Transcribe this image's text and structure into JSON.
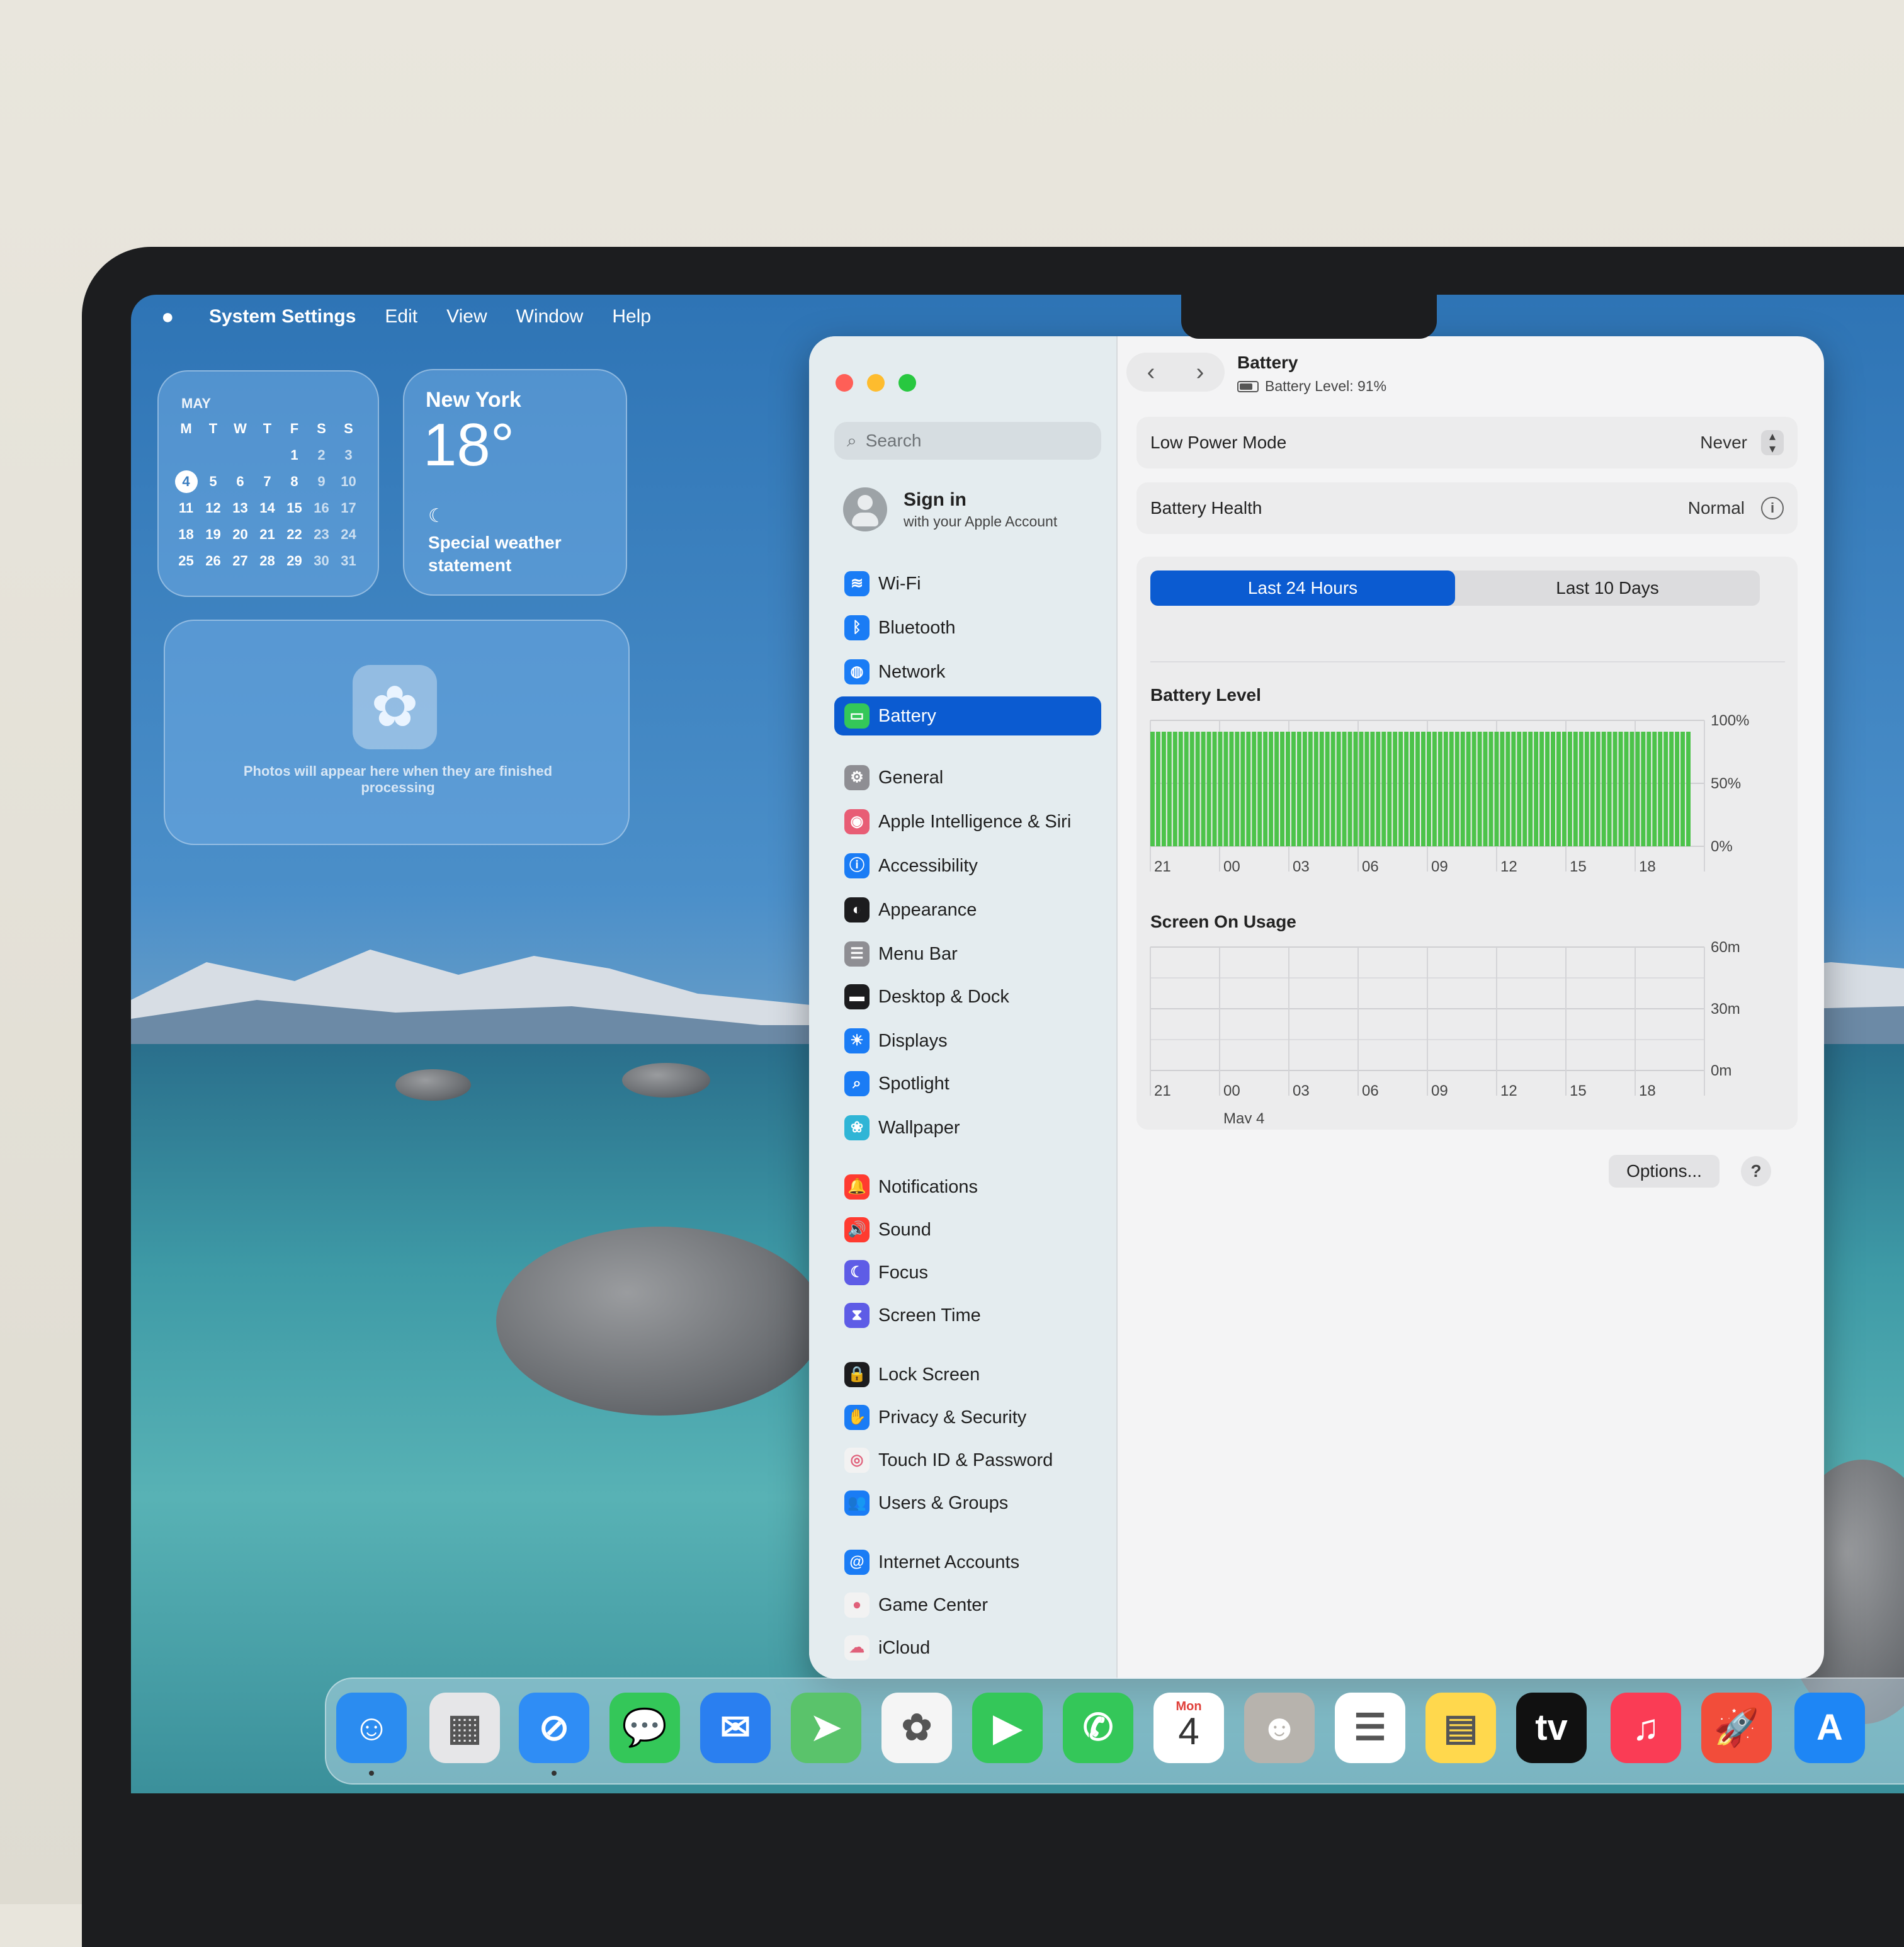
{
  "menubar": {
    "app_name": "System Settings",
    "items": [
      "Edit",
      "View",
      "Window",
      "Help"
    ]
  },
  "calendar_widget": {
    "month": "MAY",
    "weekdays": [
      "M",
      "T",
      "W",
      "T",
      "F",
      "S",
      "S"
    ],
    "weeks": [
      [
        "",
        "",
        "",
        "",
        "1",
        "2",
        "3"
      ],
      [
        "4",
        "5",
        "6",
        "7",
        "8",
        "9",
        "10"
      ],
      [
        "11",
        "12",
        "13",
        "14",
        "15",
        "16",
        "17"
      ],
      [
        "18",
        "19",
        "20",
        "21",
        "22",
        "23",
        "24"
      ],
      [
        "25",
        "26",
        "27",
        "28",
        "29",
        "30",
        "31"
      ]
    ],
    "today": "4"
  },
  "weather_widget": {
    "city": "New York",
    "temperature": "18°",
    "statement": "Special weather statement"
  },
  "photos_widget": {
    "message": "Photos will appear here when they are finished processing"
  },
  "sidebar": {
    "search_placeholder": "Search",
    "signin_title": "Sign in",
    "signin_subtitle": "with your Apple Account",
    "items": [
      {
        "label": "Wi-Fi",
        "icon": "wifi-icon",
        "color": "#1a7cf5",
        "glyph": "≋"
      },
      {
        "label": "Bluetooth",
        "icon": "bluetooth-icon",
        "color": "#1a7cf5",
        "glyph": "ᛒ"
      },
      {
        "label": "Network",
        "icon": "globe-icon",
        "color": "#1a7cf5",
        "glyph": "◍"
      },
      {
        "label": "Battery",
        "icon": "battery-icon",
        "color": "#34c759",
        "glyph": "▭",
        "selected": true
      },
      {
        "label": "General",
        "icon": "gear-icon",
        "color": "#8e8e93",
        "glyph": "⚙"
      },
      {
        "label": "Apple Intelligence & Siri",
        "icon": "siri-icon",
        "color": "#e85d75",
        "glyph": "◉"
      },
      {
        "label": "Accessibility",
        "icon": "accessibility-icon",
        "color": "#1a7cf5",
        "glyph": "ⓘ"
      },
      {
        "label": "Appearance",
        "icon": "appearance-icon",
        "color": "#1c1c1e",
        "glyph": "◐"
      },
      {
        "label": "Menu Bar",
        "icon": "menubar-icon",
        "color": "#8e8e93",
        "glyph": "☰"
      },
      {
        "label": "Desktop & Dock",
        "icon": "dock-icon",
        "color": "#1c1c1e",
        "glyph": "▬"
      },
      {
        "label": "Displays",
        "icon": "displays-icon",
        "color": "#1a7cf5",
        "glyph": "☀"
      },
      {
        "label": "Spotlight",
        "icon": "spotlight-icon",
        "color": "#1a7cf5",
        "glyph": "⌕"
      },
      {
        "label": "Wallpaper",
        "icon": "wallpaper-icon",
        "color": "#2fb5d6",
        "glyph": "❀"
      },
      {
        "label": "Notifications",
        "icon": "notifications-icon",
        "color": "#ff3b30",
        "glyph": "🔔"
      },
      {
        "label": "Sound",
        "icon": "sound-icon",
        "color": "#ff3b30",
        "glyph": "🔊"
      },
      {
        "label": "Focus",
        "icon": "focus-icon",
        "color": "#5e5ce6",
        "glyph": "☾"
      },
      {
        "label": "Screen Time",
        "icon": "hourglass-icon",
        "color": "#5e5ce6",
        "glyph": "⧗"
      },
      {
        "label": "Lock Screen",
        "icon": "lock-icon",
        "color": "#1c1c1e",
        "glyph": "🔒"
      },
      {
        "label": "Privacy & Security",
        "icon": "hand-icon",
        "color": "#1a7cf5",
        "glyph": "✋"
      },
      {
        "label": "Touch ID & Password",
        "icon": "fingerprint-icon",
        "color": "#f2f2f2",
        "glyph": "◎"
      },
      {
        "label": "Users & Groups",
        "icon": "users-icon",
        "color": "#1a7cf5",
        "glyph": "👥"
      },
      {
        "label": "Internet Accounts",
        "icon": "at-icon",
        "color": "#1a7cf5",
        "glyph": "@"
      },
      {
        "label": "Game Center",
        "icon": "gamecenter-icon",
        "color": "#f2f2f2",
        "glyph": "●"
      },
      {
        "label": "iCloud",
        "icon": "cloud-icon",
        "color": "#f2f2f2",
        "glyph": "☁"
      }
    ]
  },
  "main": {
    "title": "Battery",
    "subtitle": "Battery Level: 91%",
    "low_power_label": "Low Power Mode",
    "low_power_value": "Never",
    "health_label": "Battery Health",
    "health_value": "Normal",
    "tabs": [
      "Last 24 Hours",
      "Last 10 Days"
    ],
    "active_tab": 0,
    "options_button": "Options...",
    "help_button": "?"
  },
  "chart_data": [
    {
      "type": "bar",
      "title": "Battery Level",
      "x_ticks": [
        "21",
        "00",
        "03",
        "06",
        "09",
        "12",
        "15",
        "18"
      ],
      "y_ticks": [
        "100%",
        "50%",
        "0%"
      ],
      "ylim": [
        0,
        100
      ],
      "series": [
        {
          "values": [
            91
          ]
        }
      ],
      "color": "#4cc34a"
    },
    {
      "type": "bar",
      "title": "Screen On Usage",
      "x_ticks": [
        "21",
        "00",
        "03",
        "06",
        "09",
        "12",
        "15",
        "18"
      ],
      "x_sublabel": "May 4",
      "y_ticks": [
        "60m",
        "30m",
        "0m"
      ],
      "ylim": [
        0,
        60
      ],
      "series": [
        {
          "values": []
        }
      ]
    }
  ],
  "dock": {
    "apps": [
      {
        "name": "finder-icon",
        "color": "#2b8cf0",
        "glyph": "☺"
      },
      {
        "name": "launchpad-icon",
        "color": "#e6e6e8",
        "glyph": "▦"
      },
      {
        "name": "safari-icon",
        "color": "#2f8df5",
        "glyph": "⊘"
      },
      {
        "name": "messages-icon",
        "color": "#34c759",
        "glyph": "💬"
      },
      {
        "name": "mail-icon",
        "color": "#2a7ff0",
        "glyph": "✉"
      },
      {
        "name": "maps-icon",
        "color": "#5ac36b",
        "glyph": "➤"
      },
      {
        "name": "photos-icon",
        "color": "#f5f5f5",
        "glyph": "✿"
      },
      {
        "name": "facetime-icon",
        "color": "#34c759",
        "glyph": "▶"
      },
      {
        "name": "phone-icon",
        "color": "#34c759",
        "glyph": "✆"
      },
      {
        "name": "calendar-icon",
        "color": "#ffffff",
        "glyph": "4"
      },
      {
        "name": "contacts-icon",
        "color": "#b7b3ad",
        "glyph": "☻"
      },
      {
        "name": "reminders-icon",
        "color": "#ffffff",
        "glyph": "☰"
      },
      {
        "name": "notes-icon",
        "color": "#ffd84d",
        "glyph": "▤"
      },
      {
        "name": "appletv-icon",
        "color": "#111111",
        "glyph": "tv"
      },
      {
        "name": "music-icon",
        "color": "#fa3c55",
        "glyph": "♫"
      },
      {
        "name": "rocket-icon",
        "color": "#f24d3a",
        "glyph": "🚀"
      },
      {
        "name": "appstore-icon",
        "color": "#1e86f5",
        "glyph": "A"
      }
    ],
    "calendar_day_label": "Mon"
  }
}
